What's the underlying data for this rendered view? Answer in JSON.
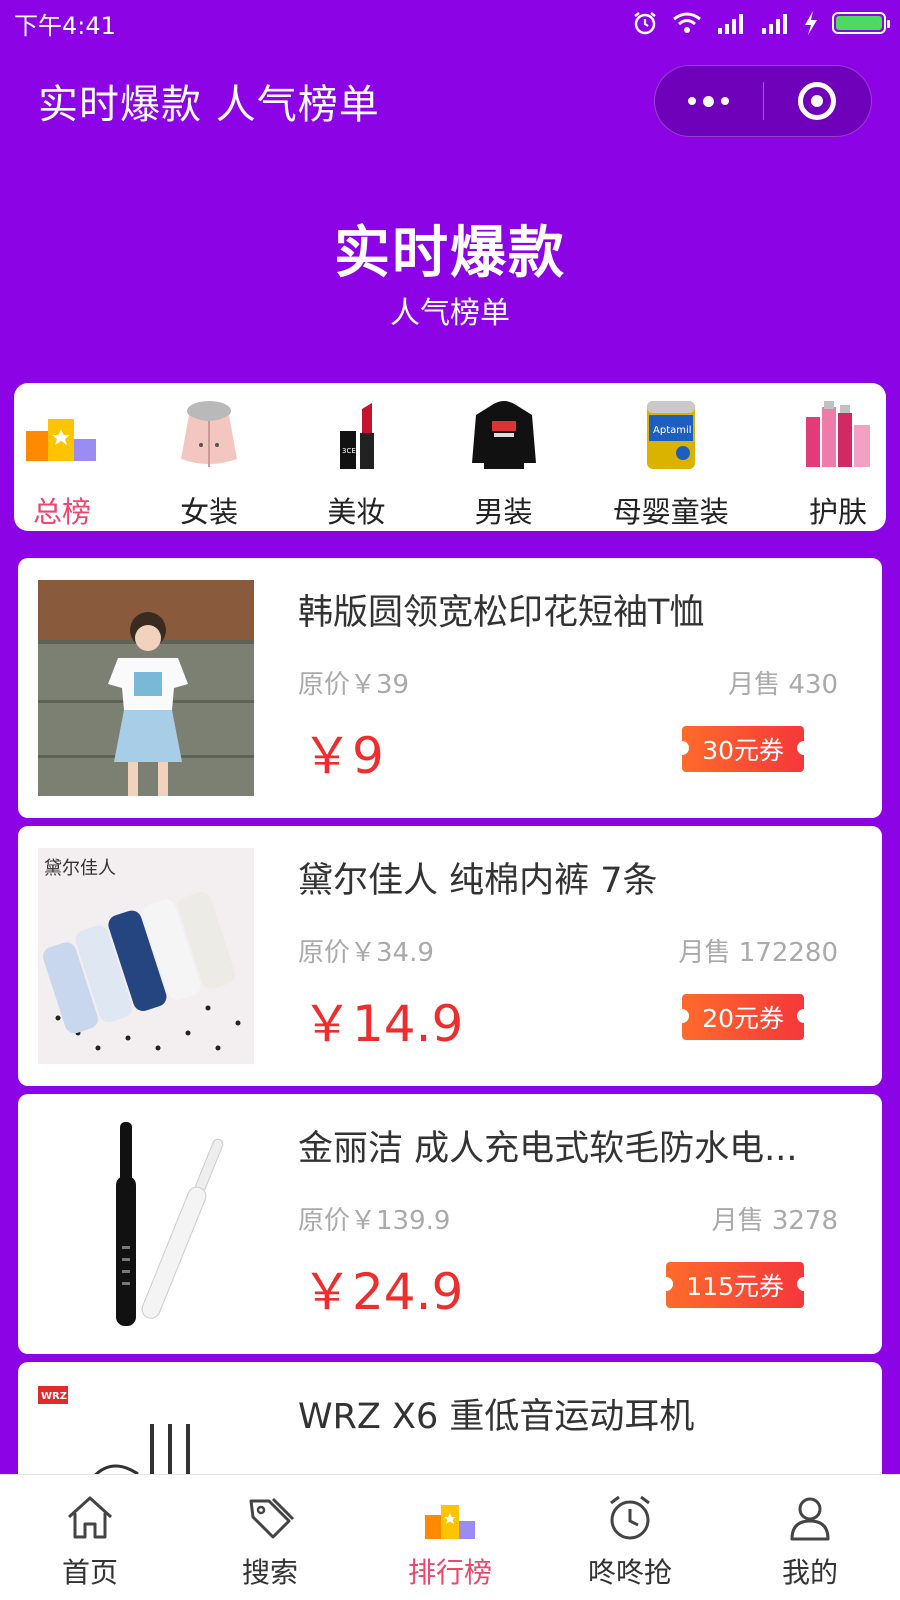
{
  "status_bar": {
    "time": "下午4:41"
  },
  "nav": {
    "title": "实时爆款 人气榜单"
  },
  "hero": {
    "title": "实时爆款",
    "subtitle": "人气榜单"
  },
  "categories": [
    {
      "label": "总榜",
      "active": true
    },
    {
      "label": "女装"
    },
    {
      "label": "美妆"
    },
    {
      "label": "男装"
    },
    {
      "label": "母婴童装"
    },
    {
      "label": "护肤"
    }
  ],
  "products": [
    {
      "title": "韩版圆领宽松印花短袖T恤",
      "orig_price": "原价￥39",
      "monthly_sales": "月售 430",
      "price": "￥9",
      "coupon": "30元券"
    },
    {
      "title": "黛尔佳人 纯棉内裤 7条",
      "orig_price": "原价￥34.9",
      "monthly_sales": "月售 172280",
      "price": "￥14.9",
      "coupon": "20元券",
      "brand_logo": "黛尔佳人"
    },
    {
      "title": "金丽洁 成人充电式软毛防水电...",
      "orig_price": "原价￥139.9",
      "monthly_sales": "月售 3278",
      "price": "￥24.9",
      "coupon": "115元券"
    },
    {
      "title": "WRZ X6 重低音运动耳机",
      "brand_logo": "WRZ"
    }
  ],
  "tabs": [
    {
      "label": "首页",
      "icon": "home-icon"
    },
    {
      "label": "搜索",
      "icon": "tag-icon"
    },
    {
      "label": "排行榜",
      "icon": "ranking-icon",
      "active": true
    },
    {
      "label": "咚咚抢",
      "icon": "alarm-clock-icon"
    },
    {
      "label": "我的",
      "icon": "user-icon"
    }
  ],
  "colors": {
    "background": "#8c04e6",
    "accent_pink": "#f0466a",
    "price_red": "#f02d2d"
  }
}
